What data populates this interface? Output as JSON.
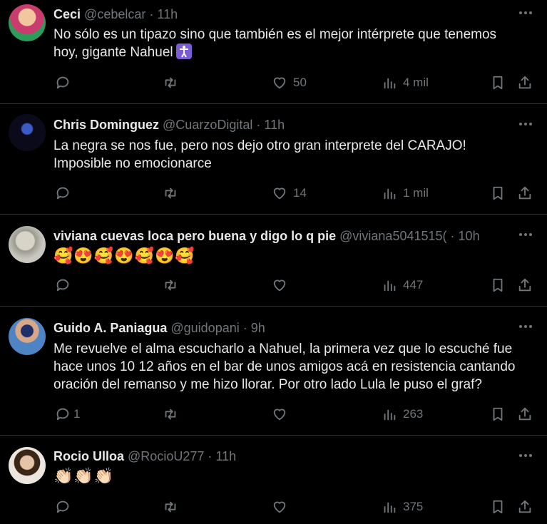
{
  "tweets": [
    {
      "name": "Ceci",
      "handle": "@cebelcar",
      "time": "11h",
      "text": [
        "No sólo es un tipazo sino que también es el mejor intérprete que tenemos",
        "hoy, gigante Nahuel"
      ],
      "emoji": "",
      "replies": "",
      "retweets": "",
      "likes": "50",
      "views": "4 mil",
      "avatar_color": "#c83c6e"
    },
    {
      "name": "Chris Dominguez",
      "handle": "@CuarzoDigital",
      "time": "11h",
      "text": [
        "La negra se nos fue, pero nos dejo otro gran interprete del CARAJO!",
        "Imposible no emocionarce"
      ],
      "emoji": "",
      "replies": "",
      "retweets": "",
      "likes": "14",
      "views": "1 mil",
      "avatar_color": "#1a2a6a"
    },
    {
      "name": "viviana cuevas loca pero buena y digo lo q pie",
      "handle": "@viviana5041515(",
      "time": "10h",
      "text": [],
      "emoji": "🥰😍🥰😍🥰😍🥰",
      "replies": "",
      "retweets": "",
      "likes": "",
      "views": "447",
      "avatar_color": "#b8b8b0"
    },
    {
      "name": "Guido A. Paniagua",
      "handle": "@guidopani",
      "time": "9h",
      "text": [
        "Me revuelve el alma escucharlo a Nahuel, la primera vez que lo escuché fue",
        "hace unos 10 12 años en el bar de unos amigos acá en resistencia cantando",
        "oración del remanso y me hizo llorar. Por otro lado Lula le puso el graf?"
      ],
      "emoji": "",
      "replies": "1",
      "retweets": "",
      "likes": "",
      "views": "263",
      "avatar_color": "#3a6ea8"
    },
    {
      "name": "Rocio Ulloa",
      "handle": "@RocioU277",
      "time": "11h",
      "text": [],
      "emoji": "👏🏻👏🏻👏🏻",
      "replies": "",
      "retweets": "",
      "likes": "",
      "views": "375",
      "avatar_color": "#e9e2da"
    }
  ],
  "separator": "·"
}
